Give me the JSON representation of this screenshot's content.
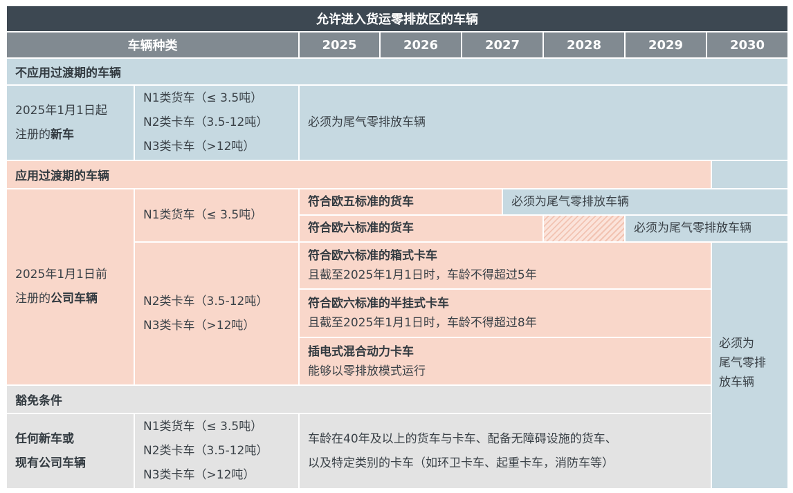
{
  "title": "允许进入货运零排放区的车辆",
  "header": {
    "vehicle_type": "车辆种类",
    "years": [
      "2025",
      "2026",
      "2027",
      "2028",
      "2029",
      "2030"
    ]
  },
  "section1": {
    "title": "不应用过渡期的车辆",
    "row_label_line1": "2025年1月1日起",
    "row_label_line2_prefix": "注册的",
    "row_label_line2_bold": "新车",
    "categories": [
      "N1类货车（≤ 3.5吨）",
      "N2类卡车（3.5-12吨）",
      "N3类卡车（>12吨）"
    ],
    "requirement": "必须为尾气零排放车辆"
  },
  "section2": {
    "title": "应用过渡期的车辆",
    "row_label_line1": "2025年1月1日前",
    "row_label_line2_prefix": "注册的",
    "row_label_line2_bold": "公司车辆",
    "n1_category": "N1类货车（≤ 3.5吨）",
    "n1_rows": [
      {
        "label": "符合欧五标准的货车",
        "requirement": "必须为尾气零排放车辆"
      },
      {
        "label": "符合欧六标准的货车",
        "requirement": "必须为尾气零排放车辆"
      }
    ],
    "n23_categories": [
      "N2类卡车（3.5-12吨）",
      "N3类卡车（>12吨）"
    ],
    "n23_rows": [
      {
        "label": "符合欧六标准的箱式卡车",
        "detail": "且截至2025年1月1日时，车龄不得超过5年"
      },
      {
        "label": "符合欧六标准的半挂式卡车",
        "detail": "且截至2025年1月1日时，车龄不得超过8年"
      },
      {
        "label": "插电式混合动力卡车",
        "detail": "能够以零排放模式运行"
      }
    ],
    "final_requirement_lines": [
      "必须为",
      "尾气零排",
      "放车辆"
    ]
  },
  "section3": {
    "title": "豁免条件",
    "row_label_lines": [
      "任何新车或",
      "现有公司车辆"
    ],
    "categories": [
      "N1类货车（≤ 3.5吨）",
      "N2类卡车（3.5-12吨）",
      "N3类卡车（>12吨）"
    ],
    "detail_lines": [
      "车龄在40年及以上的货车与卡车、配备无障碍设施的货车、",
      "以及特定类别的卡车（如环卫卡车、起重卡车，消防车等）"
    ]
  },
  "colors": {
    "title_bg": "#3d4852",
    "header_bg": "#818a91",
    "zero_emission_blue": "#c6d9e1",
    "transition_pink": "#f9d7ca",
    "exemption_gray": "#e3e3e3"
  }
}
